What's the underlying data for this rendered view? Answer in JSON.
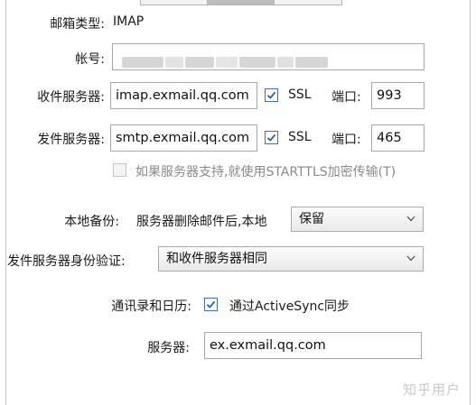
{
  "account": {
    "type_label": "邮箱类型:",
    "type_value": "IMAP",
    "account_label": "帐号:"
  },
  "incoming": {
    "label": "收件服务器:",
    "server": "imap.exmail.qq.com",
    "ssl_label": "SSL",
    "ssl_checked": true,
    "port_label": "端口:",
    "port": "993"
  },
  "outgoing": {
    "label": "发件服务器:",
    "server": "smtp.exmail.qq.com",
    "ssl_label": "SSL",
    "ssl_checked": true,
    "port_label": "端口:",
    "port": "465"
  },
  "starttls": {
    "label": "如果服务器支持,就使用STARTTLS加密传输(T)",
    "checked": false,
    "enabled": false
  },
  "backup": {
    "label": "本地备份:",
    "desc": "服务器删除邮件后,本地",
    "selected": "保留"
  },
  "smtp_auth": {
    "label": "发件服务器身份验证:",
    "selected": "和收件服务器相同"
  },
  "sync": {
    "label": "通讯录和日历:",
    "checkbox_label": "通过ActiveSync同步",
    "checked": true,
    "server_label": "服务器:",
    "server": "ex.exmail.qq.com"
  },
  "watermark": "知乎用户",
  "colors": {
    "check_accent": "#1f5fb5",
    "field_border": "#a8a8a8"
  }
}
